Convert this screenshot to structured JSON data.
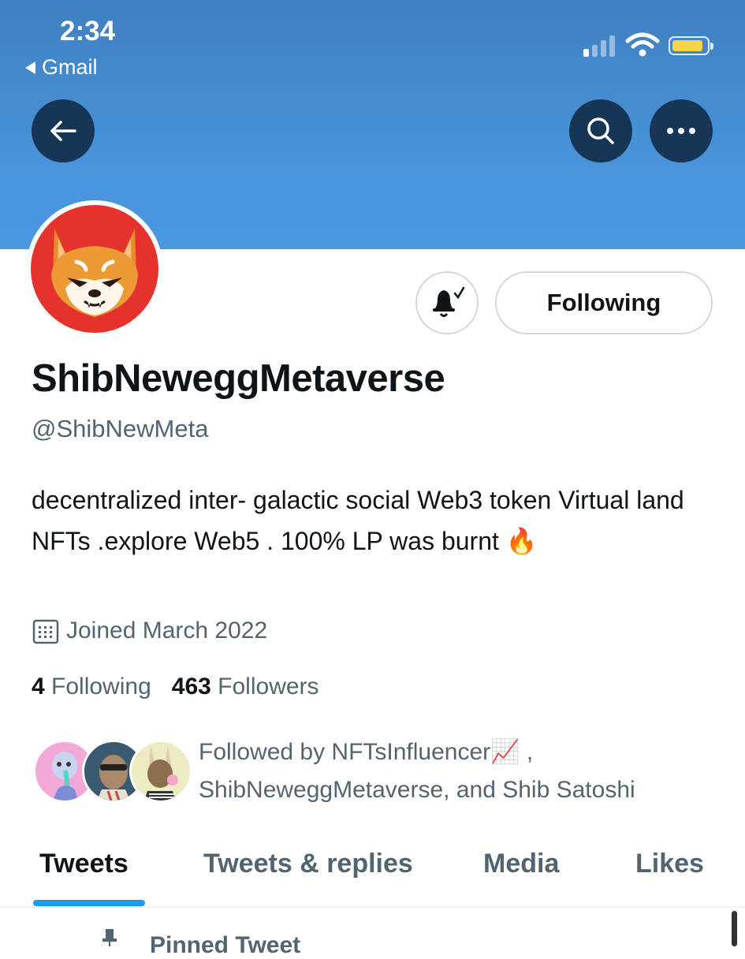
{
  "status_bar": {
    "time": "2:34",
    "back_app": "Gmail",
    "battery_color": "#f8d548"
  },
  "header": {
    "back_icon": "arrow-left-icon",
    "search_icon": "search-icon",
    "more_icon": "more-horizontal-icon",
    "banner_color": "#4791d6"
  },
  "profile": {
    "avatar_icon": "shiba-inu-avatar",
    "display_name": "ShibNeweggMetaverse",
    "handle": "@ShibNewMeta",
    "bio": "decentralized inter- galactic social Web3 token Virtual land NFTs .explore Web5 . 100% LP was burnt 🔥",
    "joined": "Joined March 2022",
    "following_count": "4",
    "following_label": "Following",
    "followers_count": "463",
    "followers_label": "Followers"
  },
  "actions": {
    "notify_icon": "bell-check-icon",
    "following_button": "Following"
  },
  "followed_by": {
    "prefix": "Followed by NFTsInfluencer",
    "emoji": "📈",
    "suffix": " ,",
    "line2": "ShibNeweggMetaverse, and Shib Satoshi"
  },
  "tabs": [
    {
      "label": "Tweets",
      "active": true
    },
    {
      "label": "Tweets & replies",
      "active": false
    },
    {
      "label": "Media",
      "active": false
    },
    {
      "label": "Likes",
      "active": false
    }
  ],
  "pinned_label": "Pinned Tweet",
  "accent_color": "#1d9bf0"
}
